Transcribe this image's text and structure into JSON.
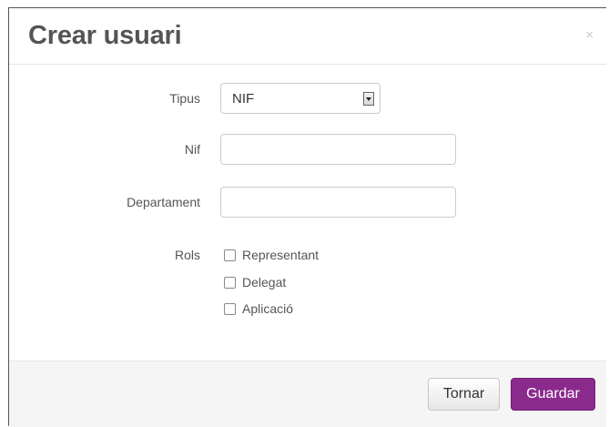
{
  "modal": {
    "title": "Crear usuari",
    "close_glyph": "×"
  },
  "form": {
    "tipus": {
      "label": "Tipus",
      "selected": "NIF"
    },
    "nif": {
      "label": "Nif",
      "value": ""
    },
    "departament": {
      "label": "Departament",
      "value": ""
    },
    "rols": {
      "label": "Rols",
      "options": [
        {
          "label": "Representant",
          "checked": false
        },
        {
          "label": "Delegat",
          "checked": false
        },
        {
          "label": "Aplicació",
          "checked": false
        }
      ]
    }
  },
  "footer": {
    "back_label": "Tornar",
    "save_label": "Guardar"
  },
  "colors": {
    "primary": "#8b2a8d",
    "footer_bg": "#f5f5f5"
  },
  "icons": {
    "close": "close-icon",
    "select_arrow": "chevron-down-icon"
  }
}
